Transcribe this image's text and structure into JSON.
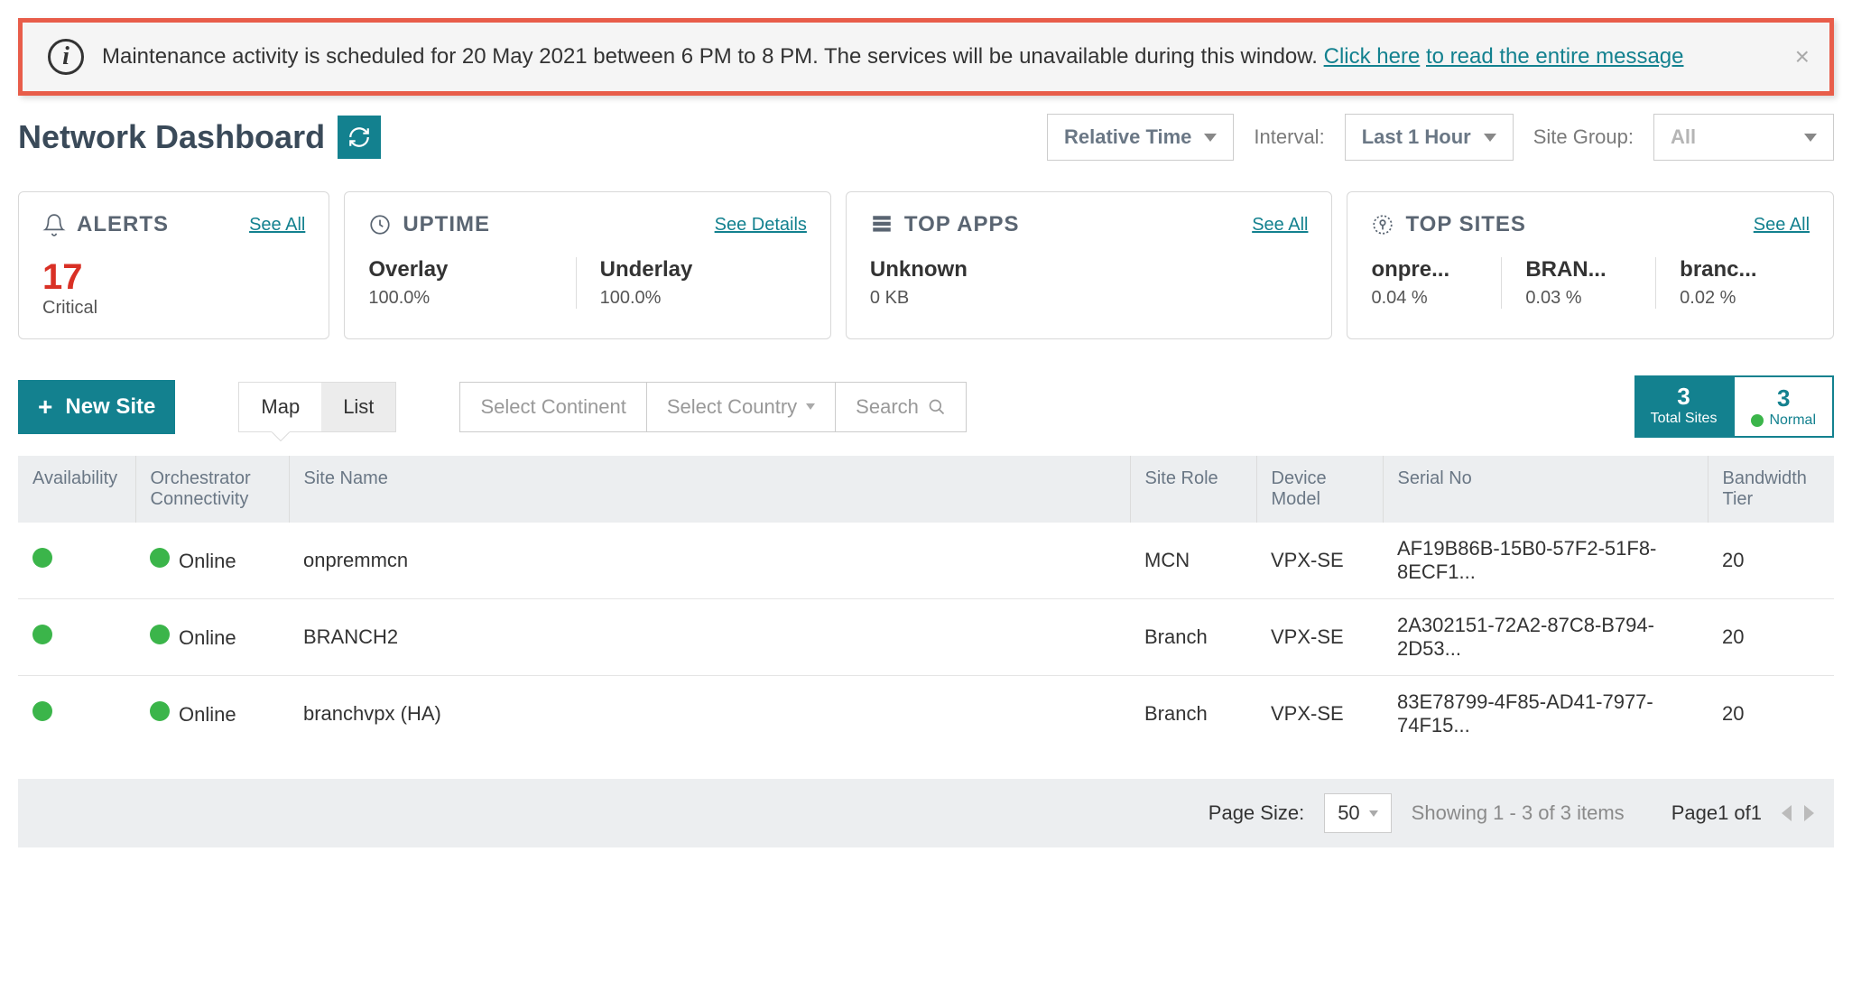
{
  "banner": {
    "text": "Maintenance activity is scheduled for 20 May 2021 between 6 PM to 8 PM. The services will be unavailable during this window. ",
    "link1": "Click here",
    "link2": "to read the entire message"
  },
  "page_title": "Network Dashboard",
  "header": {
    "time_mode": "Relative Time",
    "interval_label": "Interval:",
    "interval_value": "Last 1 Hour",
    "site_group_label": "Site Group:",
    "site_group_value": "All"
  },
  "cards": {
    "alerts": {
      "title": "ALERTS",
      "link": "See All",
      "count": "17",
      "sub": "Critical"
    },
    "uptime": {
      "title": "UPTIME",
      "link": "See Details",
      "metrics": [
        {
          "name": "Overlay",
          "value": "100.0%"
        },
        {
          "name": "Underlay",
          "value": "100.0%"
        }
      ]
    },
    "top_apps": {
      "title": "TOP APPS",
      "link": "See All",
      "metrics": [
        {
          "name": "Unknown",
          "value": "0 KB"
        }
      ]
    },
    "top_sites": {
      "title": "TOP SITES",
      "link": "See All",
      "metrics": [
        {
          "name": "onpre...",
          "value": "0.04 %"
        },
        {
          "name": "BRAN...",
          "value": "0.03 %"
        },
        {
          "name": "branc...",
          "value": "0.02 %"
        }
      ]
    }
  },
  "toolbar": {
    "new_site": "New Site",
    "tab_map": "Map",
    "tab_list": "List",
    "select_continent": "Select Continent",
    "select_country": "Select Country",
    "search": "Search",
    "counts": {
      "total_num": "3",
      "total_lbl": "Total Sites",
      "normal_num": "3",
      "normal_lbl": "Normal"
    }
  },
  "table": {
    "headers": [
      "Availability",
      "Orchestrator Connectivity",
      "Site Name",
      "Site Role",
      "Device Model",
      "Serial No",
      "Bandwidth Tier"
    ],
    "rows": [
      {
        "conn": "Online",
        "name": "onpremmcn",
        "role": "MCN",
        "model": "VPX-SE",
        "serial": "AF19B86B-15B0-57F2-51F8-8ECF1...",
        "bw": "20"
      },
      {
        "conn": "Online",
        "name": "BRANCH2",
        "role": "Branch",
        "model": "VPX-SE",
        "serial": "2A302151-72A2-87C8-B794-2D53...",
        "bw": "20"
      },
      {
        "conn": "Online",
        "name": "branchvpx (HA)",
        "role": "Branch",
        "model": "VPX-SE",
        "serial": "83E78799-4F85-AD41-7977-74F15...",
        "bw": "20"
      }
    ]
  },
  "footer": {
    "page_size_label": "Page Size:",
    "page_size_value": "50",
    "showing": "Showing 1 - 3 of 3 items",
    "page": "Page1 of1"
  }
}
